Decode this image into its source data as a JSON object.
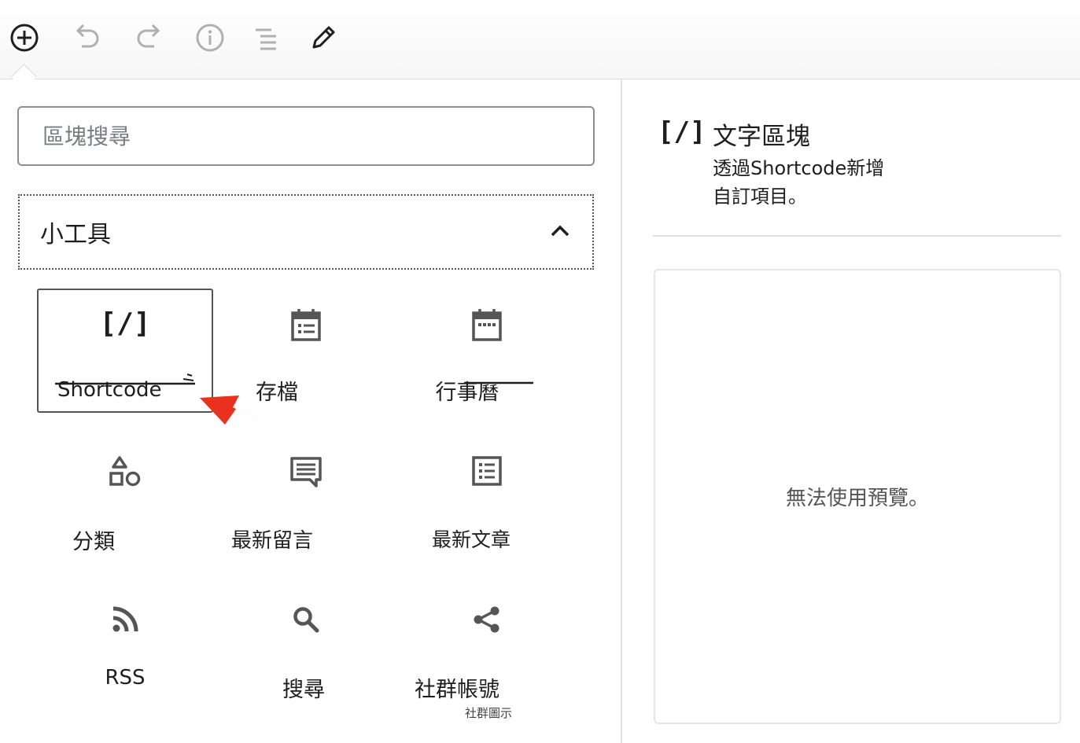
{
  "toolbar": {
    "buttons": [
      {
        "name": "add-block",
        "icon": "plus-circle-icon"
      },
      {
        "name": "undo",
        "icon": "undo-icon"
      },
      {
        "name": "redo",
        "icon": "redo-icon"
      },
      {
        "name": "info",
        "icon": "info-icon"
      },
      {
        "name": "outline",
        "icon": "list-view-icon"
      },
      {
        "name": "edit",
        "icon": "pencil-icon"
      }
    ]
  },
  "inserter": {
    "search_placeholder": "區塊搜尋",
    "category_title": "小工具",
    "blocks": [
      {
        "label": "Shortcode",
        "icon": "shortcode-icon",
        "icon_text": "[/]"
      },
      {
        "label": "存檔",
        "icon": "archive-calendar-icon"
      },
      {
        "label": "行事曆",
        "icon": "calendar-icon"
      },
      {
        "label": "分類",
        "icon": "categories-shapes-icon"
      },
      {
        "label": "最新留言",
        "icon": "comment-icon"
      },
      {
        "label": "最新文章",
        "icon": "post-list-icon"
      },
      {
        "label": "RSS",
        "icon": "rss-icon"
      },
      {
        "label": "搜尋",
        "icon": "search-icon"
      },
      {
        "label": "社群帳號",
        "icon": "share-icon",
        "sublabel": "社群圖示"
      }
    ]
  },
  "preview": {
    "icon_text": "[/]",
    "title": "文字區塊",
    "description": "透過Shortcode新增自訂項目。",
    "empty_message": "無法使用預覽。"
  },
  "colors": {
    "text": "#1e1e1e",
    "icon": "#555555",
    "muted_icon": "#b0b0b0",
    "annotation": "#e8311f"
  }
}
